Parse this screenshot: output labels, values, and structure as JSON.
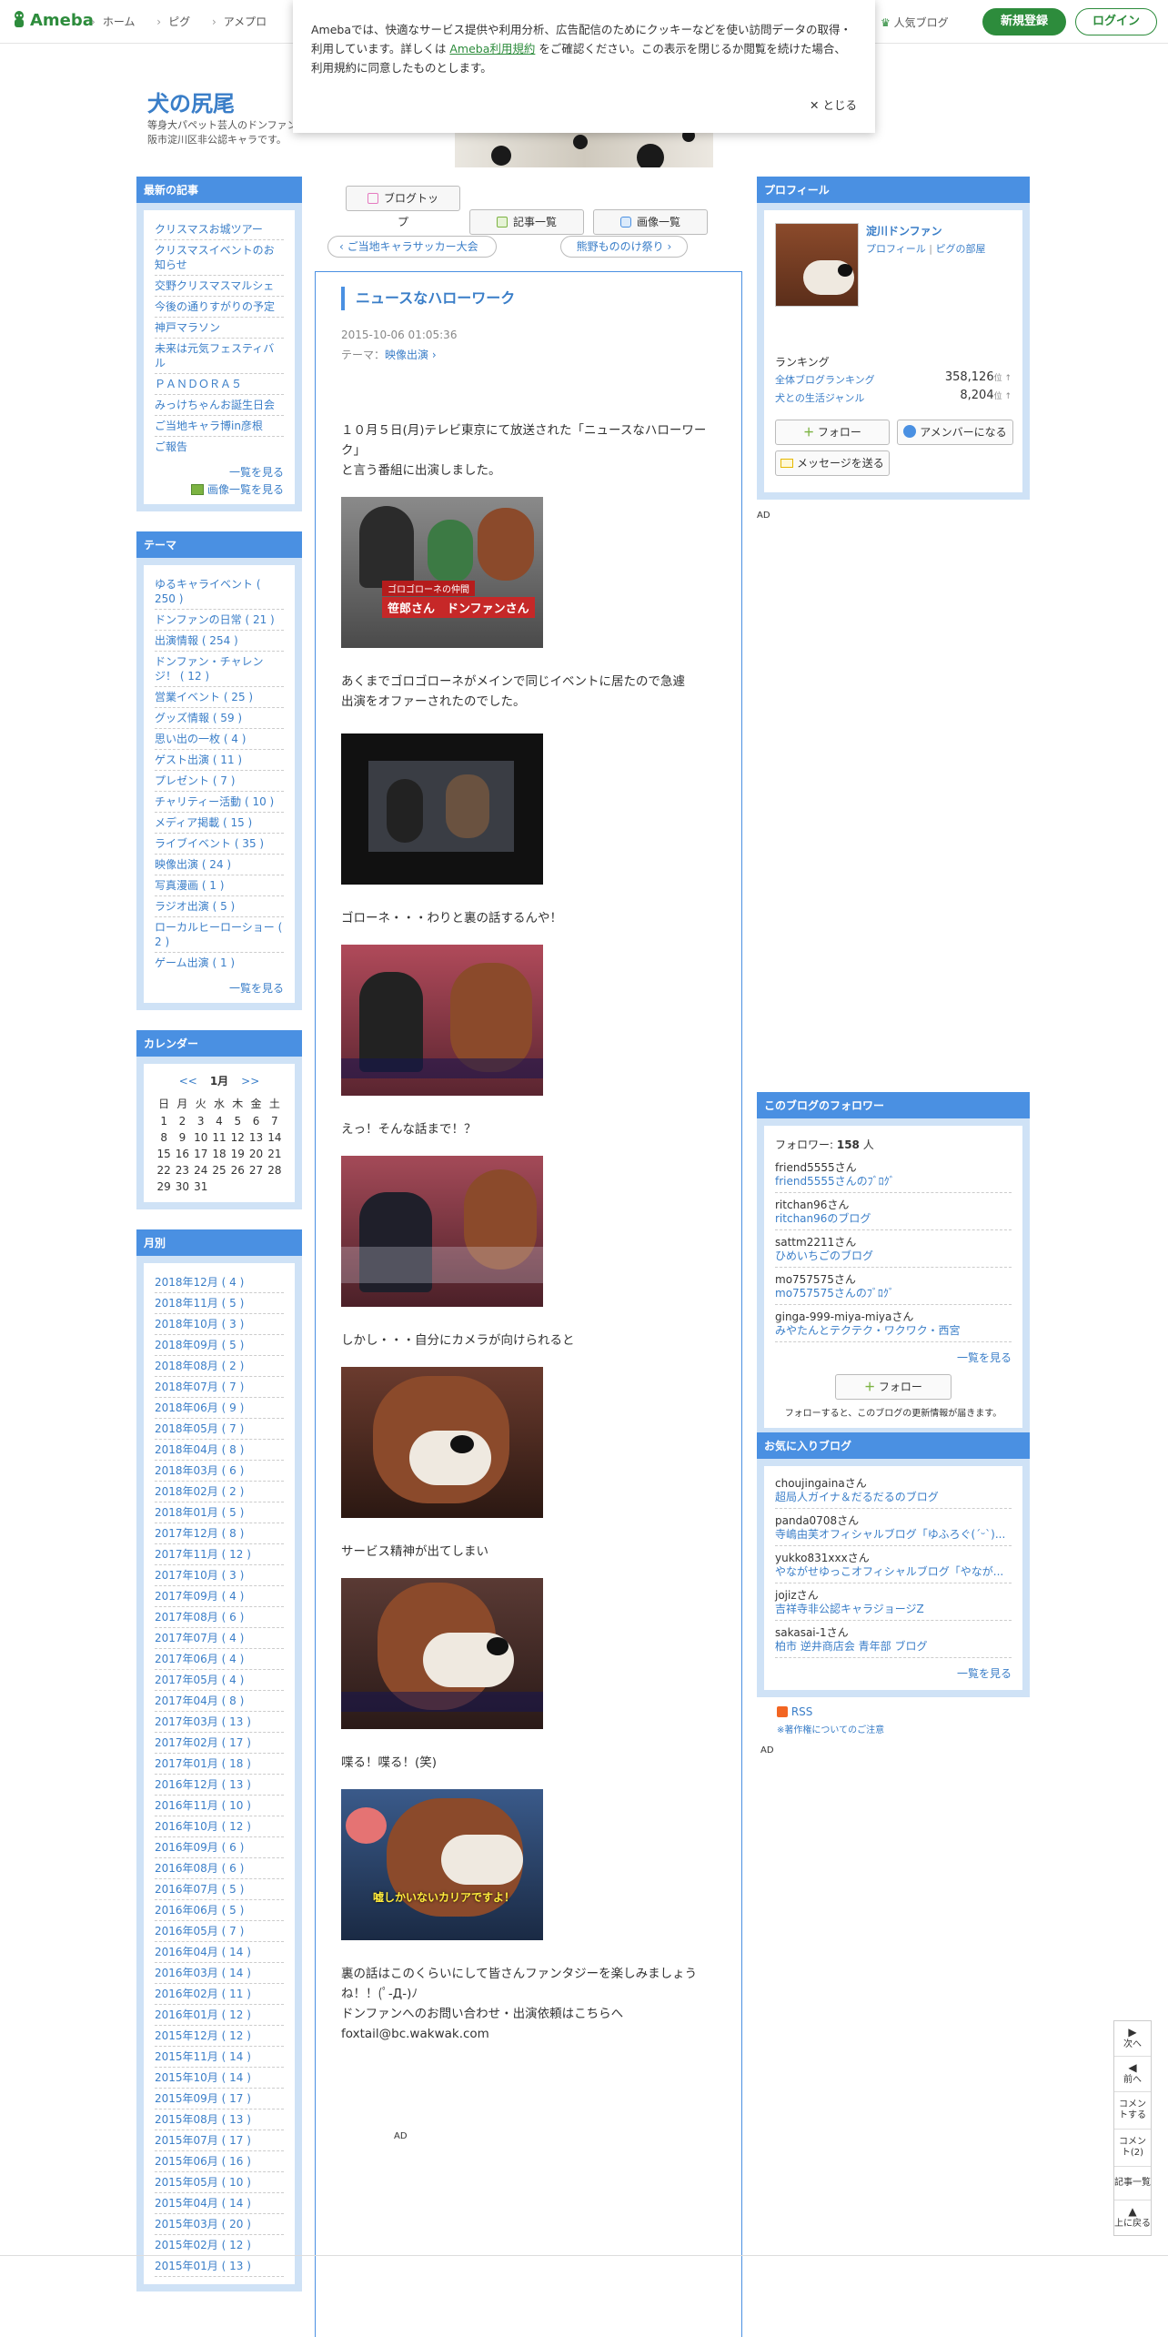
{
  "header": {
    "logo": "Ameba",
    "nav": [
      "ホーム",
      "ピグ",
      "アメプロ"
    ],
    "popular": "人気ブログ",
    "register": "新規登録",
    "login": "ログイン"
  },
  "cookie": {
    "text1": "Amebaでは、快適なサービス提供や利用分析、広告配信のためにクッキーなどを使い訪問データの取得・利用しています。詳しくは",
    "link": "Ameba利用規約",
    "text2": "をご確認ください。この表示を閉じるか閲覧を続けた場合、利用規約に同意したものとします。",
    "close": "とじる"
  },
  "blog": {
    "title": "犬の尻尾",
    "desc": "等身大パペット芸人のドンファン大阪市淀川区非公認キャラです。"
  },
  "left": {
    "latest": {
      "title": "最新の記事",
      "items": [
        "クリスマスお城ツアー",
        "クリスマスイベントのお知らせ",
        "交野クリスマスマルシェ",
        "今後の通りすがりの予定",
        "神戸マラソン",
        "未来は元気フェスティバル",
        "ＰＡＮＤＯＲＡ５",
        "みっけちゃんお誕生日会",
        "ご当地キャラ博in彦根",
        "ご報告"
      ],
      "more": "一覧を見る",
      "images": "画像一覧を見る"
    },
    "themes": {
      "title": "テーマ",
      "items": [
        "ゆるキャライベント ( 250 )",
        "ドンファンの日常 ( 21 )",
        "出演情報 ( 254 )",
        "ドンファン・チャレンジ！ ( 12 )",
        "営業イベント ( 25 )",
        "グッズ情報 ( 59 )",
        "思い出の一枚 ( 4 )",
        "ゲスト出演 ( 11 )",
        "プレゼント ( 7 )",
        "チャリティー活動 ( 10 )",
        "メディア掲載 ( 15 )",
        "ライブイベント ( 35 )",
        "映像出演 ( 24 )",
        "写真漫画 ( 1 )",
        "ラジオ出演 ( 5 )",
        "ローカルヒーローショー ( 2 )",
        "ゲーム出演 ( 1 )"
      ],
      "more": "一覧を見る"
    },
    "calendar": {
      "title": "カレンダー",
      "prev": "<<",
      "month": "1月",
      "next": ">>",
      "weekdays": [
        "日",
        "月",
        "火",
        "水",
        "木",
        "金",
        "土"
      ],
      "rows": [
        [
          "1",
          "2",
          "3",
          "4",
          "5",
          "6",
          "7"
        ],
        [
          "8",
          "9",
          "10",
          "11",
          "12",
          "13",
          "14"
        ],
        [
          "15",
          "16",
          "17",
          "18",
          "19",
          "20",
          "21"
        ],
        [
          "22",
          "23",
          "24",
          "25",
          "26",
          "27",
          "28"
        ],
        [
          "29",
          "30",
          "31",
          "",
          "",
          "",
          ""
        ]
      ]
    },
    "monthly": {
      "title": "月別",
      "items": [
        "2018年12月 ( 4 )",
        "2018年11月 ( 5 )",
        "2018年10月 ( 3 )",
        "2018年09月 ( 5 )",
        "2018年08月 ( 2 )",
        "2018年07月 ( 7 )",
        "2018年06月 ( 9 )",
        "2018年05月 ( 7 )",
        "2018年04月 ( 8 )",
        "2018年03月 ( 6 )",
        "2018年02月 ( 2 )",
        "2018年01月 ( 5 )",
        "2017年12月 ( 8 )",
        "2017年11月 ( 12 )",
        "2017年10月 ( 3 )",
        "2017年09月 ( 4 )",
        "2017年08月 ( 6 )",
        "2017年07月 ( 4 )",
        "2017年06月 ( 4 )",
        "2017年05月 ( 4 )",
        "2017年04月 ( 8 )",
        "2017年03月 ( 13 )",
        "2017年02月 ( 17 )",
        "2017年01月 ( 18 )",
        "2016年12月 ( 13 )",
        "2016年11月 ( 10 )",
        "2016年10月 ( 12 )",
        "2016年09月 ( 6 )",
        "2016年08月 ( 6 )",
        "2016年07月 ( 5 )",
        "2016年06月 ( 5 )",
        "2016年05月 ( 7 )",
        "2016年04月 ( 14 )",
        "2016年03月 ( 14 )",
        "2016年02月 ( 11 )",
        "2016年01月 ( 12 )",
        "2015年12月 ( 12 )",
        "2015年11月 ( 14 )",
        "2015年10月 ( 14 )",
        "2015年09月 ( 17 )",
        "2015年08月 ( 13 )",
        "2015年07月 ( 17 )",
        "2015年06月 ( 16 )",
        "2015年05月 ( 10 )",
        "2015年04月 ( 14 )",
        "2015年03月 ( 20 )",
        "2015年02月 ( 12 )",
        "2015年01月 ( 13 )"
      ]
    }
  },
  "toolbar": {
    "top": "ブログトップ",
    "list": "記事一覧",
    "images": "画像一覧"
  },
  "pager": {
    "prev": "ご当地キャラサッカー大会",
    "next": "熊野もののけ祭り"
  },
  "article": {
    "title": "ニュースなハローワーク",
    "date": "2015-10-06 01:05:36",
    "theme_label": "テーマ：",
    "theme": "映像出演",
    "p1a": "１０月５日(月)テレビ東京にて放送された「ニュースなハローワーク」",
    "p1b": "と言う番組に出演しました。",
    "cap1": "ゴロゴローネの仲間",
    "cap1b": "笹郎さん　ドンファンさん",
    "p2a": "あくまでゴロゴローネがメインで同じイベントに居たので急遽",
    "p2b": "出演をオファーされたのでした。",
    "p3": "ゴローネ・・・わりと裏の話するんや！",
    "p4": "えっ！そんな話まで！？",
    "p5": "しかし・・・自分にカメラが向けられると",
    "p6": "サービス精神が出てしまい",
    "p7": "喋る！喋る！(笑)",
    "cap7": "嘘しかいないカリアですよ！",
    "p8a": "裏の話はこのくらいにして皆さんファンタジーを楽しみましょうね！！(ﾟ-Д-)ﾉ",
    "p8b": "ドンファンへのお問い合わせ・出演依頼はこちらへ",
    "p8c": "foxtail@bc.wakwak.com",
    "ad": "AD"
  },
  "right": {
    "profile": {
      "title": "プロフィール",
      "name": "淀川ドンファン",
      "profile_link": "プロフィール",
      "room_link": "ピグの部屋",
      "sep": "|",
      "ranking_label": "ランキング",
      "rank1_label": "全体ブログランキング",
      "rank1_value": "358,126",
      "rank2_label": "犬との生活ジャンル",
      "rank2_value": "8,204",
      "rank_unit": "位 ↑",
      "follow": "フォロー",
      "member": "アメンバーになる",
      "message": "メッセージを送る"
    },
    "ad": "AD",
    "followers": {
      "title": "このブログのフォロワー",
      "count_label": "フォロワー: ",
      "count": "158",
      "count_unit": " 人",
      "items": [
        {
          "user": "friend5555さん",
          "blog": "friend5555さんのﾌﾞﾛｸﾞ"
        },
        {
          "user": "ritchan96さん",
          "blog": "ritchan96のブログ"
        },
        {
          "user": "sattm2211さん",
          "blog": "ひめいちごのブログ"
        },
        {
          "user": "mo757575さん",
          "blog": "mo757575さんのﾌﾞﾛｸﾞ"
        },
        {
          "user": "ginga-999-miya-miyaさん",
          "blog": "みやたんとテクテク・ワクワク・西宮"
        }
      ],
      "more": "一覧を見る",
      "follow": "フォロー",
      "note": "フォローすると、このブログの更新情報が届きます。"
    },
    "favorites": {
      "title": "お気に入りブログ",
      "items": [
        {
          "user": "choujingainaさん",
          "blog": "超局人ガイナ＆だるだるのブログ"
        },
        {
          "user": "panda0708さん",
          "blog": "寺嶋由芙オフィシャルブログ「ゆふろぐ(ˊᵕˋ)..."
        },
        {
          "user": "yukko831xxxさん",
          "blog": "やながせゆっこオフィシャルブログ「やなが..."
        },
        {
          "user": "jojizさん",
          "blog": "吉祥寺非公認キャラジョージZ"
        },
        {
          "user": "sakasai-1さん",
          "blog": "柏市 逆井商店会 青年部 ブログ"
        }
      ],
      "more": "一覧を見る"
    },
    "rss": "RSS",
    "copyright": "※著作権についてのご注意",
    "ad2": "AD"
  },
  "sidenav": [
    "次へ",
    "前へ",
    "コメントする",
    "コメント(2)",
    "記事一覧",
    "上に戻る"
  ]
}
